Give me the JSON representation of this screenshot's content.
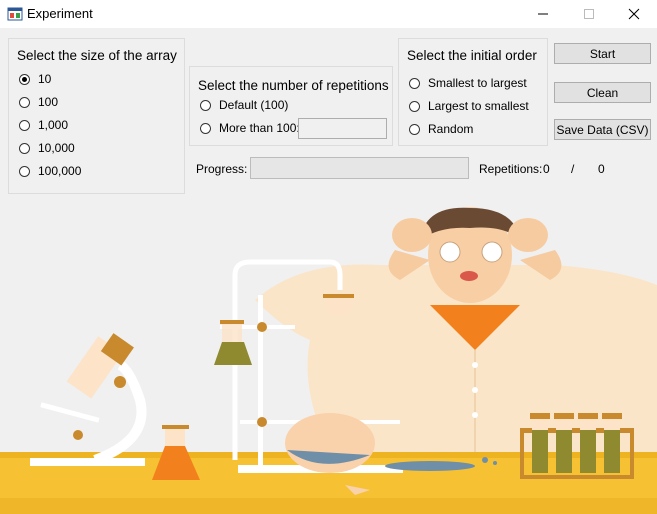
{
  "window": {
    "title": "Experiment",
    "icon": "app-window-icon",
    "minimize": "–",
    "maximize": "☐",
    "close": "✕"
  },
  "array_size": {
    "title": "Select the size of the array",
    "selected": "10",
    "options": [
      "10",
      "100",
      "1,000",
      "10,000",
      "100,000"
    ]
  },
  "repetitions": {
    "title": "Select the number of repetitions",
    "options": [
      "Default (100)",
      "More than 100:"
    ],
    "custom_value": ""
  },
  "initial_order": {
    "title": "Select the initial order",
    "options": [
      "Smallest to largest",
      "Largest to smallest",
      "Random"
    ]
  },
  "buttons": {
    "start": "Start",
    "clean": "Clean",
    "save": "Save Data (CSV)"
  },
  "progress": {
    "label": "Progress:",
    "value": 0
  },
  "repetition_counter": {
    "label": "Repetitions:",
    "current": "0",
    "separator": "/",
    "total": "0"
  },
  "colors": {
    "accent_orange": "#f2811d",
    "table_yellow": "#f6c233",
    "lab_coat": "#fbe5c9",
    "liquid_green": "#8f8a2f"
  }
}
